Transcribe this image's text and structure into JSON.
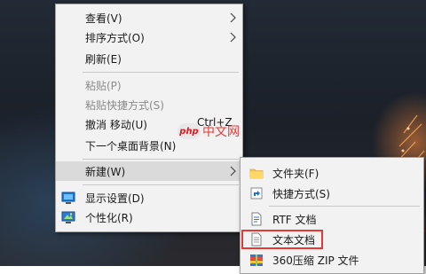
{
  "desktop_menu": {
    "items": [
      {
        "label": "查看(V)",
        "has_submenu": true
      },
      {
        "label": "排序方式(O)",
        "has_submenu": true
      },
      {
        "label": "刷新(E)"
      },
      {
        "label": "粘贴(P)",
        "disabled": true
      },
      {
        "label": "粘贴快捷方式(S)",
        "disabled": true
      },
      {
        "label": "撤消 移动(U)",
        "shortcut": "Ctrl+Z"
      },
      {
        "label": "下一个桌面背景(N)"
      },
      {
        "label": "新建(W)",
        "has_submenu": true,
        "hovered": true
      },
      {
        "label": "显示设置(D)",
        "icon": "display-settings-icon"
      },
      {
        "label": "个性化(R)",
        "icon": "personalize-icon"
      }
    ]
  },
  "new_submenu": {
    "items": [
      {
        "label": "文件夹(F)",
        "icon": "folder-icon"
      },
      {
        "label": "快捷方式(S)",
        "icon": "shortcut-icon"
      },
      {
        "label": "RTF 文档",
        "icon": "rtf-document-icon"
      },
      {
        "label": "文本文档",
        "icon": "text-document-icon",
        "highlighted": true
      },
      {
        "label": "360压缩 ZIP 文件",
        "icon": "zip-archive-icon"
      }
    ]
  },
  "watermark": {
    "logo": "php",
    "text": "中文网"
  },
  "colors": {
    "highlight_border": "#e53935",
    "menu_bg": "#f2f2f2",
    "hover_bg": "#dadada"
  }
}
